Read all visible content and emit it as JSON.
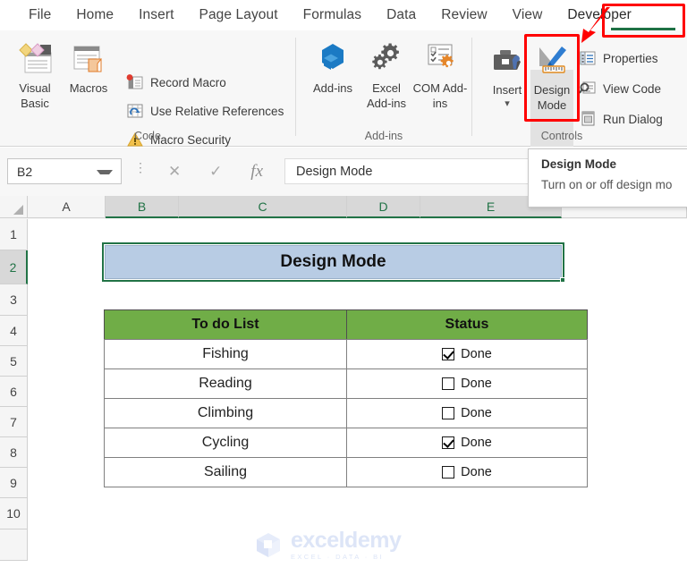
{
  "ribbon": {
    "tabs": [
      {
        "label": "File"
      },
      {
        "label": "Home"
      },
      {
        "label": "Insert"
      },
      {
        "label": "Page Layout"
      },
      {
        "label": "Formulas"
      },
      {
        "label": "Data"
      },
      {
        "label": "Review"
      },
      {
        "label": "View"
      },
      {
        "label": "Developer"
      }
    ],
    "active_tab": "Developer",
    "groups": [
      {
        "name": "Code"
      },
      {
        "name": "Add-ins"
      },
      {
        "name": "Controls"
      }
    ],
    "code_group": {
      "visual_basic": "Visual Basic",
      "macros": "Macros",
      "record_macro": "Record Macro",
      "use_relative_references": "Use Relative References",
      "macro_security": "Macro Security"
    },
    "addins_group": {
      "addins": "Add-ins",
      "excel_addins": "Excel Add-ins",
      "com_addins": "COM Add-ins"
    },
    "controls_group": {
      "insert": "Insert",
      "design_mode": "Design Mode",
      "properties": "Properties",
      "view_code": "View Code",
      "run_dialog": "Run Dialog"
    },
    "annotation_color": "#ff0000",
    "accent_color": "#1e7145"
  },
  "formula_bar": {
    "name_box": "B2",
    "formula_value": "Design Mode",
    "cancel_icon": "✕",
    "enter_icon": "✓",
    "function_icon": "fx"
  },
  "tooltip": {
    "title": "Design Mode",
    "body": "Turn on or off design mo"
  },
  "sheet": {
    "columns": [
      "A",
      "B",
      "C",
      "D",
      "E"
    ],
    "selected_columns": [
      "B",
      "C",
      "D",
      "E"
    ],
    "rows": [
      "1",
      "2",
      "3",
      "4",
      "5",
      "6",
      "7",
      "8",
      "9",
      "10"
    ],
    "selected_row": "2",
    "title_cell": {
      "text": "Design Mode",
      "fill_color": "#b8cce4",
      "selection_color": "#217346"
    },
    "table": {
      "headers": [
        "To do List",
        "Status"
      ],
      "header_fill": "#70ad47",
      "rows": [
        {
          "task": "Fishing",
          "status_label": "Done",
          "checked": true
        },
        {
          "task": "Reading",
          "status_label": "Done",
          "checked": false
        },
        {
          "task": "Climbing",
          "status_label": "Done",
          "checked": false
        },
        {
          "task": "Cycling",
          "status_label": "Done",
          "checked": true
        },
        {
          "task": "Sailing",
          "status_label": "Done",
          "checked": false
        }
      ]
    }
  },
  "watermark": {
    "name": "exceldemy",
    "tagline": "EXCEL · DATA · BI"
  }
}
